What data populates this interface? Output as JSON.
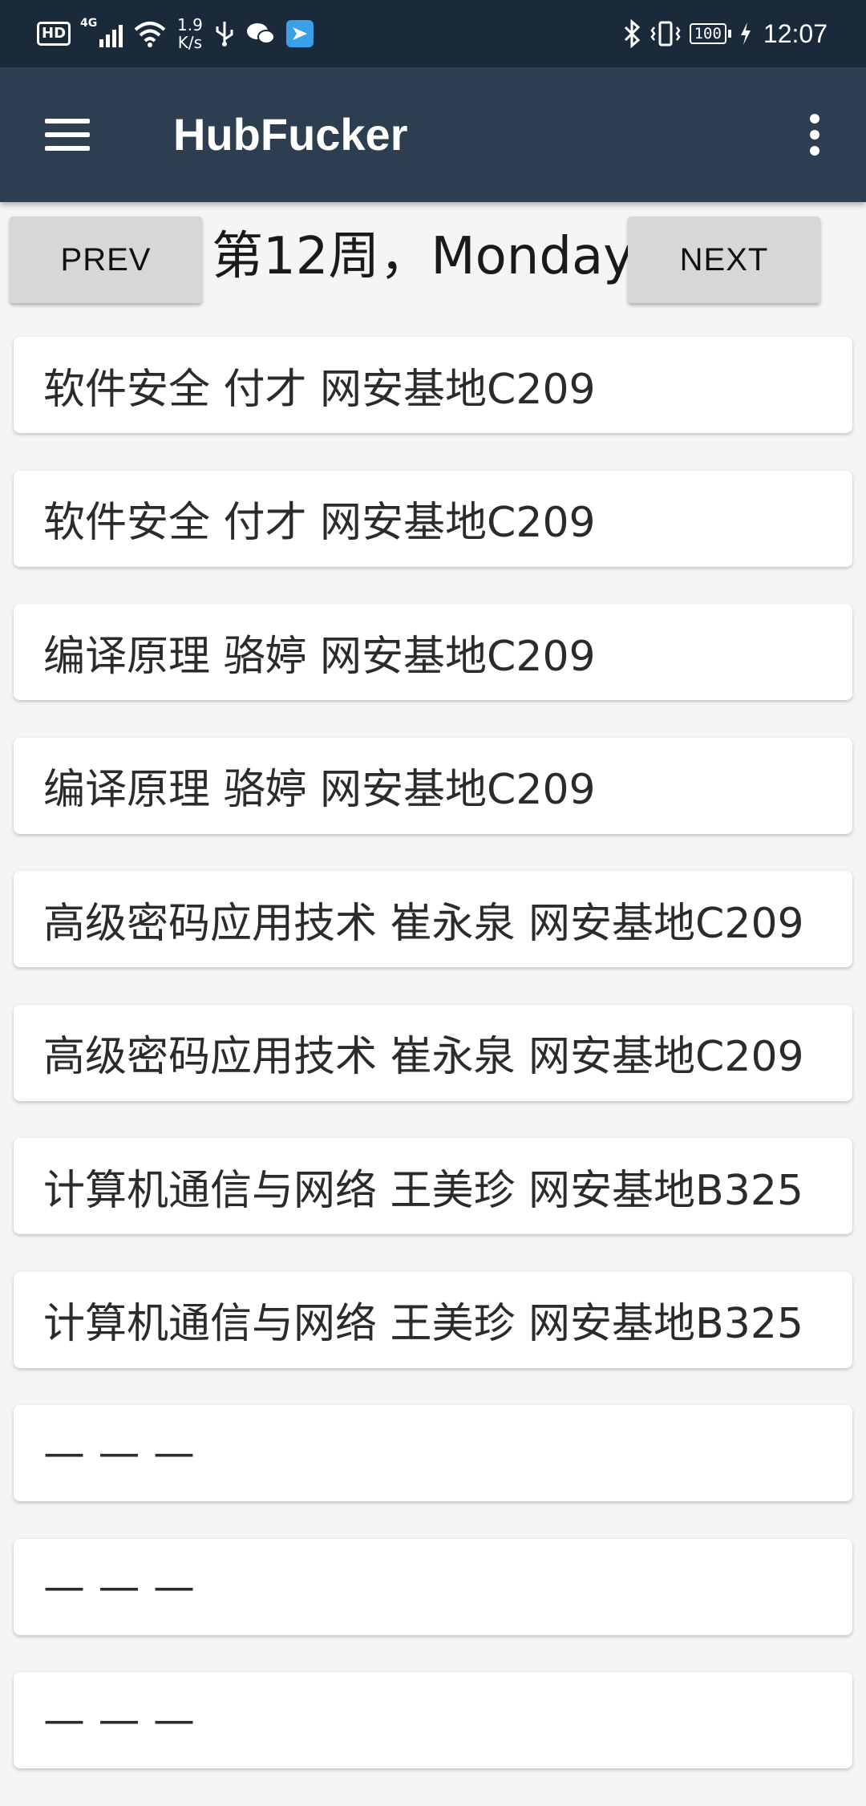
{
  "status_bar": {
    "hd_label": "HD",
    "signal_label": "4G",
    "net_speed_value": "1.9",
    "net_speed_unit": "K/s",
    "battery_level": "100",
    "time": "12:07"
  },
  "app_bar": {
    "title": "HubFucker"
  },
  "nav": {
    "prev_label": "PREV",
    "next_label": "NEXT",
    "day_label": "第12周，Monday"
  },
  "classes": [
    "软件安全 付才 网安基地C209",
    "软件安全 付才 网安基地C209",
    "编译原理 骆婷 网安基地C209",
    "编译原理 骆婷 网安基地C209",
    "高级密码应用技术 崔永泉 网安基地C209",
    "高级密码应用技术 崔永泉 网安基地C209",
    "计算机通信与网络 王美珍 网安基地B325",
    "计算机通信与网络 王美珍 网安基地B325",
    "— — —",
    "— — —",
    "— — —"
  ],
  "colors": {
    "status_bar_bg": "#1b2a3a",
    "app_bar_bg": "#2c3e50",
    "page_bg": "#f5f5f5",
    "button_bg": "#d6d7d7",
    "card_bg": "#ffffff"
  }
}
